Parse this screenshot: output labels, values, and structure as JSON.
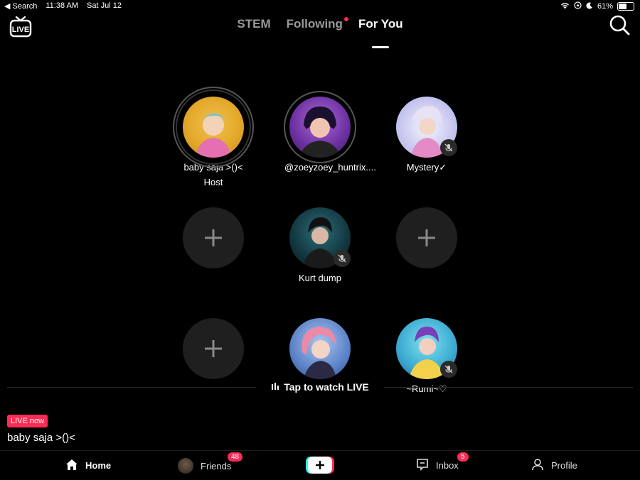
{
  "status_bar": {
    "back": "◀ Search",
    "time": "11:38 AM",
    "date": "Sat Jul 12",
    "battery": "61%",
    "battery_level": 0.61
  },
  "header": {
    "logo_text": "LIVE",
    "tabs": [
      {
        "label": "STEM",
        "active": false
      },
      {
        "label": "Following",
        "active": false,
        "dot": true
      },
      {
        "label": "For You",
        "active": true
      }
    ]
  },
  "seats": {
    "host": {
      "name": "baby saja >()<",
      "role": "Host"
    },
    "guest_1": {
      "name": "@zoeyzoey_huntrix...."
    },
    "guest_2": {
      "name": "Mystery✓"
    },
    "guest_3": {
      "name": "Kurt dump"
    },
    "guest_4": {
      "name": ""
    },
    "guest_5": {
      "name": "~Rumi~♡"
    }
  },
  "tap_to_watch": "Tap to watch LIVE",
  "live_now": {
    "badge": "LIVE now",
    "host_name": "baby saja >()<"
  },
  "nav": {
    "home": "Home",
    "friends": "Friends",
    "friends_badge": "48",
    "inbox": "Inbox",
    "inbox_badge": "5",
    "profile": "Profile"
  },
  "colors": {
    "accent": "#fe2c55",
    "cyan": "#25f4ee",
    "background": "#000000"
  }
}
